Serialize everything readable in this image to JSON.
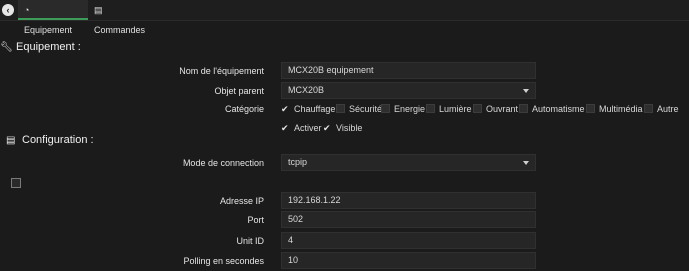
{
  "tabs": [
    {
      "label": "Equipement",
      "icon": "tachometer-icon",
      "active": true
    },
    {
      "label": "Commandes",
      "icon": "list-icon",
      "active": false
    }
  ],
  "sections": {
    "equipement": {
      "title": "Equipement :",
      "icon": "wrench-icon"
    },
    "configuration": {
      "title": "Configuration :",
      "icon": "list-icon"
    }
  },
  "fields": {
    "nom": {
      "label": "Nom de l'équipement",
      "value": "MCX20B equipement"
    },
    "objet_parent": {
      "label": "Objet parent",
      "value": "MCX20B"
    },
    "categorie": {
      "label": "Catégorie"
    },
    "mode_connexion": {
      "label": "Mode de connection",
      "value": "tcpip"
    },
    "adresse_ip": {
      "label": "Adresse IP",
      "value": "192.168.1.22"
    },
    "port": {
      "label": "Port",
      "value": "502"
    },
    "unit_id": {
      "label": "Unit ID",
      "value": "4"
    },
    "polling": {
      "label": "Polling en secondes",
      "value": "10"
    }
  },
  "categories": [
    {
      "label": "Chauffage",
      "checked": true
    },
    {
      "label": "Sécurité",
      "checked": false
    },
    {
      "label": "Energie",
      "checked": false
    },
    {
      "label": "Lumière",
      "checked": false
    },
    {
      "label": "Ouvrant",
      "checked": false
    },
    {
      "label": "Automatisme",
      "checked": false
    },
    {
      "label": "Multimédia",
      "checked": false
    },
    {
      "label": "Autre",
      "checked": false
    }
  ],
  "options": [
    {
      "label": "Activer",
      "checked": true
    },
    {
      "label": "Visible",
      "checked": true
    }
  ],
  "colors": {
    "accent": "#3d9c58",
    "background": "#1b1b1b",
    "field": "#262626"
  }
}
